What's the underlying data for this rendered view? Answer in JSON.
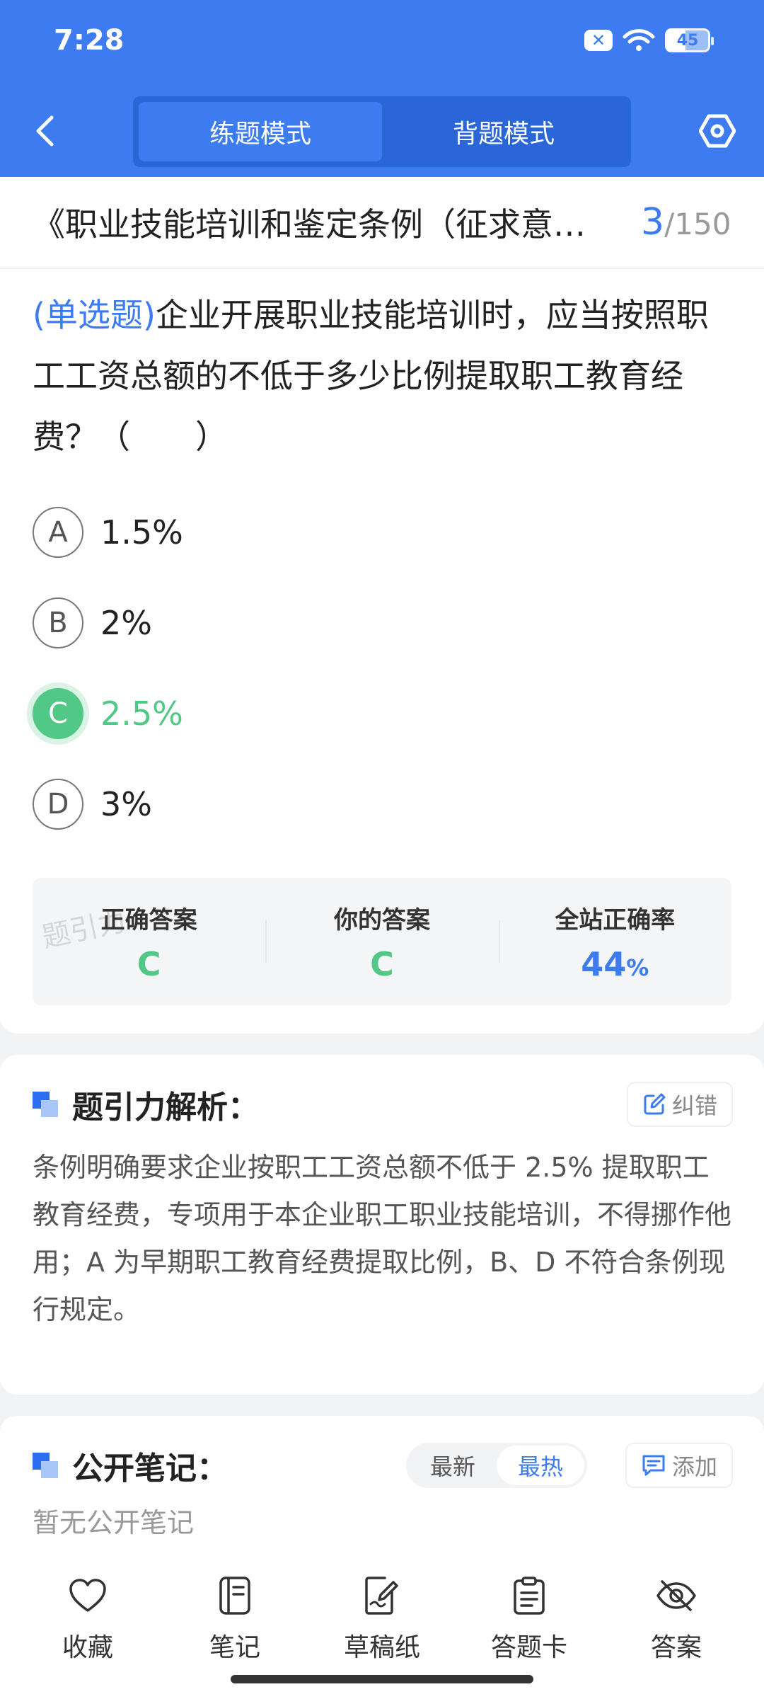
{
  "status_bar": {
    "time": "7:28",
    "battery": "45"
  },
  "header": {
    "tabs": [
      {
        "label": "练题模式",
        "active": true
      },
      {
        "label": "背题模式",
        "active": false
      }
    ],
    "accent_color": "#3d7cf0"
  },
  "quiz": {
    "title": "《职业技能培训和鉴定条例（征求意见稿）》",
    "current": "3",
    "total": "/150"
  },
  "question": {
    "type": "(单选题)",
    "text": "企业开展职业技能培训时，应当按照职工工资总额的不低于多少比例提取职工教育经费？（　　）",
    "options": [
      {
        "letter": "A",
        "text": "1.5%",
        "correct": false
      },
      {
        "letter": "B",
        "text": "2%",
        "correct": false
      },
      {
        "letter": "C",
        "text": "2.5%",
        "correct": true
      },
      {
        "letter": "D",
        "text": "3%",
        "correct": false
      }
    ]
  },
  "answer_summary": {
    "correct_label": "正确答案",
    "correct_value": "C",
    "yours_label": "你的答案",
    "yours_value": "C",
    "rate_label": "全站正确率",
    "rate_value": "44",
    "rate_unit": "%",
    "watermark": "题引力"
  },
  "analysis": {
    "title": "题引力解析：",
    "report_label": "纠错",
    "text": "条例明确要求企业按职工工资总额不低于 2.5% 提取职工教育经费，专项用于本企业职工职业技能培训，不得挪作他用；A 为早期职工教育经费提取比例，B、D 不符合条例现行规定。"
  },
  "notes": {
    "title": "公开笔记：",
    "sort_latest": "最新",
    "sort_hot": "最热",
    "add_label": "添加",
    "empty_text": "暂无公开笔记"
  },
  "bottom_bar": {
    "favorite": "收藏",
    "notes": "笔记",
    "scratch": "草稿纸",
    "answer_card": "答题卡",
    "answer": "答案"
  },
  "colors": {
    "correct_green": "#52c886",
    "primary_blue": "#3d7cf0"
  }
}
